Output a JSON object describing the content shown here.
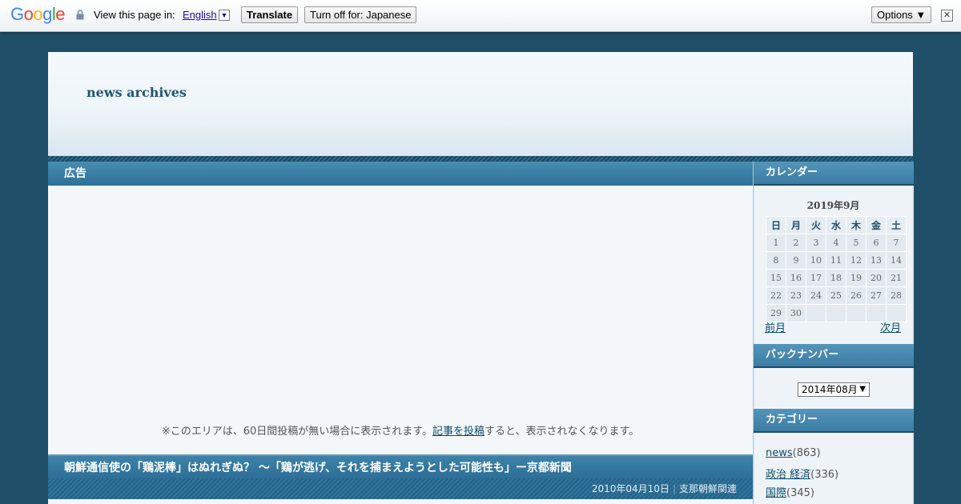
{
  "translate_bar": {
    "logo_letters": [
      "G",
      "o",
      "o",
      "g",
      "l",
      "e"
    ],
    "logo_colors": [
      "#4285f4",
      "#ea4335",
      "#fbbc05",
      "#4285f4",
      "#34a853",
      "#ea4335"
    ],
    "view_in_label": "View this page in:",
    "language": "English",
    "translate_button": "Translate",
    "turn_off_button": "Turn off for: Japanese",
    "options_button": "Options ▼",
    "close_symbol": "✕"
  },
  "site": {
    "title": "news archives"
  },
  "ad_section": {
    "heading": "広告",
    "note_before": "※このエリアは、60日間投稿が無い場合に表示されます。",
    "note_link": "記事を投稿",
    "note_after": "すると、表示されなくなります。"
  },
  "post": {
    "title": "朝鮮通信使の「鶏泥棒」はぬれぎぬ？ ～「鶏が逃げ、それを捕まえようとした可能性も」ー京都新聞",
    "date": "2010年04月10日",
    "category": "支那朝鮮関連"
  },
  "sidebar": {
    "calendar": {
      "heading": "カレンダー",
      "caption": "2019年9月",
      "weekdays": [
        "日",
        "月",
        "火",
        "水",
        "木",
        "金",
        "土"
      ],
      "weeks": [
        [
          "1",
          "2",
          "3",
          "4",
          "5",
          "6",
          "7"
        ],
        [
          "8",
          "9",
          "10",
          "11",
          "12",
          "13",
          "14"
        ],
        [
          "15",
          "16",
          "17",
          "18",
          "19",
          "20",
          "21"
        ],
        [
          "22",
          "23",
          "24",
          "25",
          "26",
          "27",
          "28"
        ],
        [
          "29",
          "30",
          "",
          "",
          "",
          "",
          ""
        ]
      ],
      "prev": "前月",
      "next": "次月"
    },
    "backnumber": {
      "heading": "バックナンバー",
      "selected": "2014年08月"
    },
    "categories": {
      "heading": "カテゴリー",
      "items": [
        {
          "name": "news",
          "count": "(863)"
        },
        {
          "name": "政治 経済",
          "count": "(336)"
        },
        {
          "name": "国際",
          "count": "(345)"
        }
      ]
    }
  },
  "colors": {
    "page_bg": "#1f4e68",
    "accent": "#2e7198",
    "link": "#0b4c6e"
  }
}
